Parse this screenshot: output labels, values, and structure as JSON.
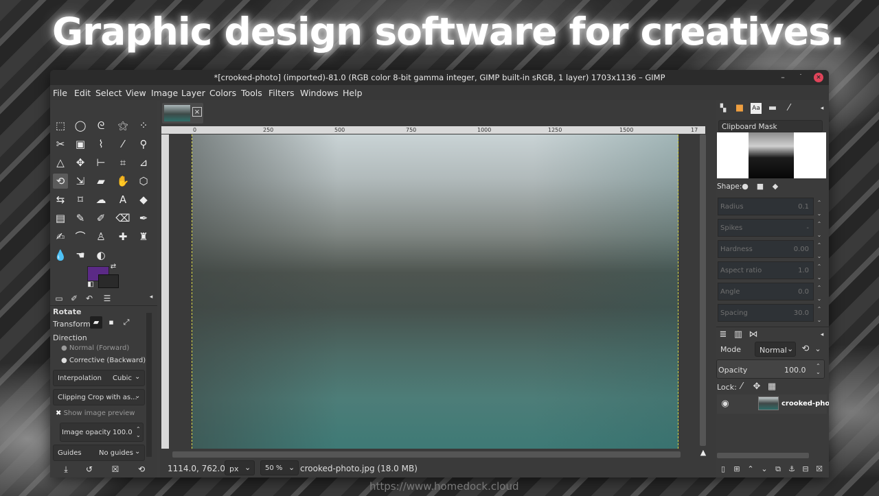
{
  "headline": "Graphic design software for creatives.",
  "footer_url": "https://www.homedock.cloud",
  "window": {
    "title": "*[crooked-photo] (imported)-81.0 (RGB color 8-bit gamma integer, GIMP built-in sRGB, 1 layer) 1703x1136 – GIMP",
    "minimize": "–",
    "maximize": "˙",
    "close": "×"
  },
  "menu": [
    "File",
    "Edit",
    "Select",
    "View",
    "Image",
    "Layer",
    "Colors",
    "Tools",
    "Filters",
    "Windows",
    "Help"
  ],
  "tool_options": {
    "title": "Rotate",
    "transform_label": "Transform:",
    "direction_label": "Direction",
    "direction_options": [
      "Normal (Forward)",
      "Corrective (Backward)"
    ],
    "interpolation_label": "Interpolation",
    "interpolation_value": "Cubic",
    "clipping_value": "Clipping Crop with as...",
    "show_preview_label": "Show image preview",
    "image_opacity_label": "Image opacity",
    "image_opacity_value": "100.0",
    "guides_label": "Guides",
    "guides_value": "No guides"
  },
  "ruler_ticks": [
    "0",
    "250",
    "500",
    "750",
    "1000",
    "1250",
    "1500",
    "17"
  ],
  "status": {
    "coords": "1114.0, 762.0",
    "unit": "px",
    "zoom": "50 %",
    "file": "crooked-photo.jpg (18.0 MB)"
  },
  "brushes": {
    "title": "Clipboard Mask",
    "shape_label": "Shape:",
    "params": [
      {
        "name": "Radius",
        "value": "0.1"
      },
      {
        "name": "Spikes",
        "value": "-"
      },
      {
        "name": "Hardness",
        "value": "0.00"
      },
      {
        "name": "Aspect ratio",
        "value": "1.0"
      },
      {
        "name": "Angle",
        "value": "0.0"
      },
      {
        "name": "Spacing",
        "value": "30.0"
      }
    ]
  },
  "layers": {
    "mode_label": "Mode",
    "mode_value": "Normal",
    "opacity_label": "Opacity",
    "opacity_value": "100.0",
    "lock_label": "Lock:",
    "layer_name": "crooked-phot"
  },
  "colors": {
    "foreground": "#5b2a86",
    "background": "#2a2a2a",
    "accent_close": "#e0445a"
  }
}
